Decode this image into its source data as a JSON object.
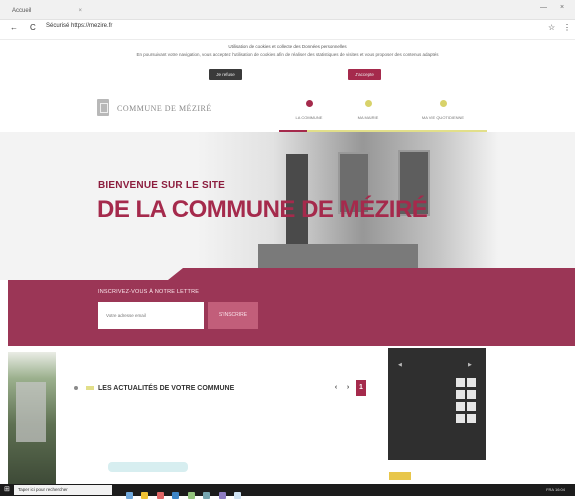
{
  "browser": {
    "tab_label": "Accueil",
    "tab_close": "×",
    "url": "Sécurisé https://mezire.fr",
    "back_glyph": "←",
    "reload_glyph": "C",
    "menu_glyph": "⋮",
    "star_glyph": "☆",
    "minimize_glyph": "—",
    "close_glyph": "×"
  },
  "cookie": {
    "title": "Utilisation de cookies et collecte des Données personnelles",
    "text": "En poursuivant votre navigation, vous acceptez l'utilisation de cookies afin de réaliser des statistiques de visites et vous proposer des contenus adaptés",
    "refuse_label": "Je refuse",
    "accept_label": "J'accepte"
  },
  "header": {
    "logo_text": "COMMUNE DE MÉZIRÉ",
    "nav": [
      {
        "label": "LA COMMUNE",
        "color": "#a52a4c"
      },
      {
        "label": "MA MAIRIE",
        "color": "#d8d26a"
      },
      {
        "label": "MA VIE QUOTIDIENNE",
        "color": "#d8d26a"
      }
    ]
  },
  "hero": {
    "subtitle": "BIENVENUE SUR LE SITE",
    "title": "DE LA COMMUNE DE MÉZIRÉ"
  },
  "newsletter": {
    "title": "INSCRIVEZ-VOUS À NOTRE LETTRE",
    "placeholder": "Votre adresse email",
    "button_label": "S'INSCRIRE"
  },
  "news": {
    "title": "LES ACTUALITÉS DE VOTRE COMMUNE",
    "prev_label": "‹",
    "next_label": "›",
    "active_label": "1"
  },
  "calendar": {
    "prev_label": "◀",
    "month_label": "",
    "next_label": "▶"
  },
  "taskbar": {
    "search_text": "Taper ici pour rechercher",
    "tray_text": "FRA 16:04"
  },
  "colors": {
    "brand": "#a52a4c",
    "band": "#9b3656",
    "accent_yellow": "#e2df8a"
  }
}
